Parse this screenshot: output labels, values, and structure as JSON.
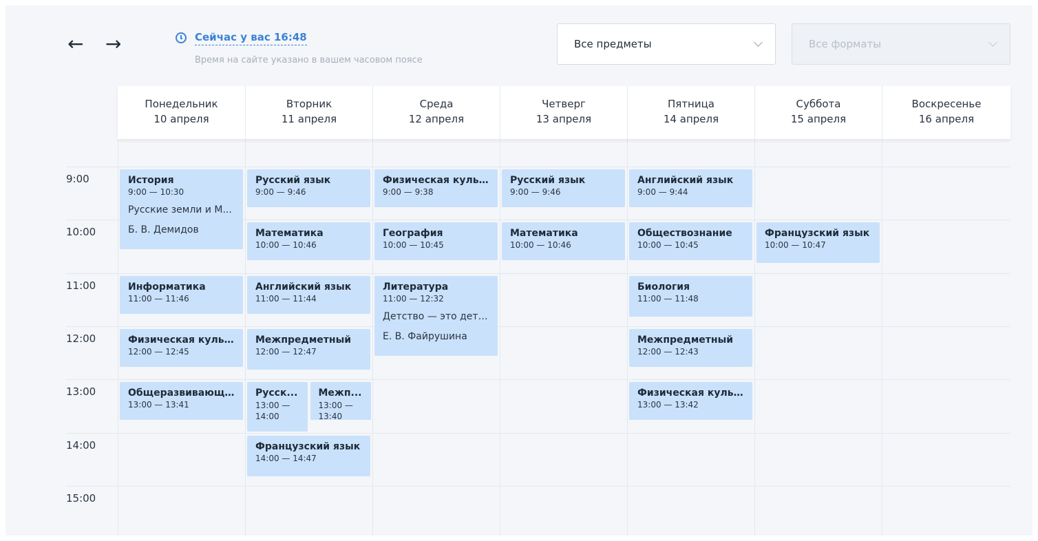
{
  "nav": {
    "prev_icon": "arrow-left-icon",
    "next_icon": "arrow-right-icon",
    "prev_glyph": "←",
    "next_glyph": "→"
  },
  "clock": {
    "now_text": "Сейчас у вас 16:48",
    "timezone_note": "Время на сайте указано в вашем часовом поясе",
    "icon": "clock-icon"
  },
  "filters": {
    "subject_value": "Все предметы",
    "format_placeholder": "Все форматы"
  },
  "days": [
    {
      "name": "Понедельник",
      "date": "10 апреля"
    },
    {
      "name": "Вторник",
      "date": "11 апреля"
    },
    {
      "name": "Среда",
      "date": "12 апреля"
    },
    {
      "name": "Четверг",
      "date": "13 апреля"
    },
    {
      "name": "Пятница",
      "date": "14 апреля"
    },
    {
      "name": "Суббота",
      "date": "15 апреля"
    },
    {
      "name": "Воскресенье",
      "date": "16 апреля"
    }
  ],
  "hours": [
    "9:00",
    "10:00",
    "11:00",
    "12:00",
    "13:00",
    "14:00",
    "15:00"
  ],
  "events": [
    {
      "day": 0,
      "title": "История",
      "time": "9:00 — 10:30",
      "desc": "Русские земли и М...",
      "teacher": "Б. В. Демидов"
    },
    {
      "day": 0,
      "title": "Информатика",
      "time": "11:00 — 11:46"
    },
    {
      "day": 0,
      "title": "Физическая культ...",
      "time": "12:00 — 12:45"
    },
    {
      "day": 0,
      "title": "Общеразвивающи...",
      "time": "13:00 — 13:41"
    },
    {
      "day": 1,
      "title": "Русский язык",
      "time": "9:00 — 9:46"
    },
    {
      "day": 1,
      "title": "Математика",
      "time": "10:00 — 10:46"
    },
    {
      "day": 1,
      "title": "Английский язык",
      "time": "11:00 — 11:44"
    },
    {
      "day": 1,
      "title": "Межпредметный",
      "time": "12:00 — 12:47"
    },
    {
      "day": 1,
      "title": "Русск...",
      "time": "13:00 — 14:00"
    },
    {
      "day": 1,
      "title": "Межп...",
      "time": "13:00 — 13:40"
    },
    {
      "day": 1,
      "title": "Французский язык",
      "time": "14:00 — 14:47"
    },
    {
      "day": 2,
      "title": "Физическая культ...",
      "time": "9:00 — 9:38"
    },
    {
      "day": 2,
      "title": "География",
      "time": "10:00 — 10:45"
    },
    {
      "day": 2,
      "title": "Литература",
      "time": "11:00 — 12:32",
      "desc": "Детство — это детс...",
      "teacher": "Е. В. Файрушина"
    },
    {
      "day": 3,
      "title": "Русский язык",
      "time": "9:00 — 9:46"
    },
    {
      "day": 3,
      "title": "Математика",
      "time": "10:00 — 10:46"
    },
    {
      "day": 4,
      "title": "Английский язык",
      "time": "9:00 — 9:44"
    },
    {
      "day": 4,
      "title": "Обществознание",
      "time": "10:00 — 10:45"
    },
    {
      "day": 4,
      "title": "Биология",
      "time": "11:00 — 11:48"
    },
    {
      "day": 4,
      "title": "Межпредметный",
      "time": "12:00 — 12:43"
    },
    {
      "day": 4,
      "title": "Физическая культ...",
      "time": "13:00 — 13:42"
    },
    {
      "day": 5,
      "title": "Французский язык",
      "time": "10:00 — 10:47"
    }
  ]
}
